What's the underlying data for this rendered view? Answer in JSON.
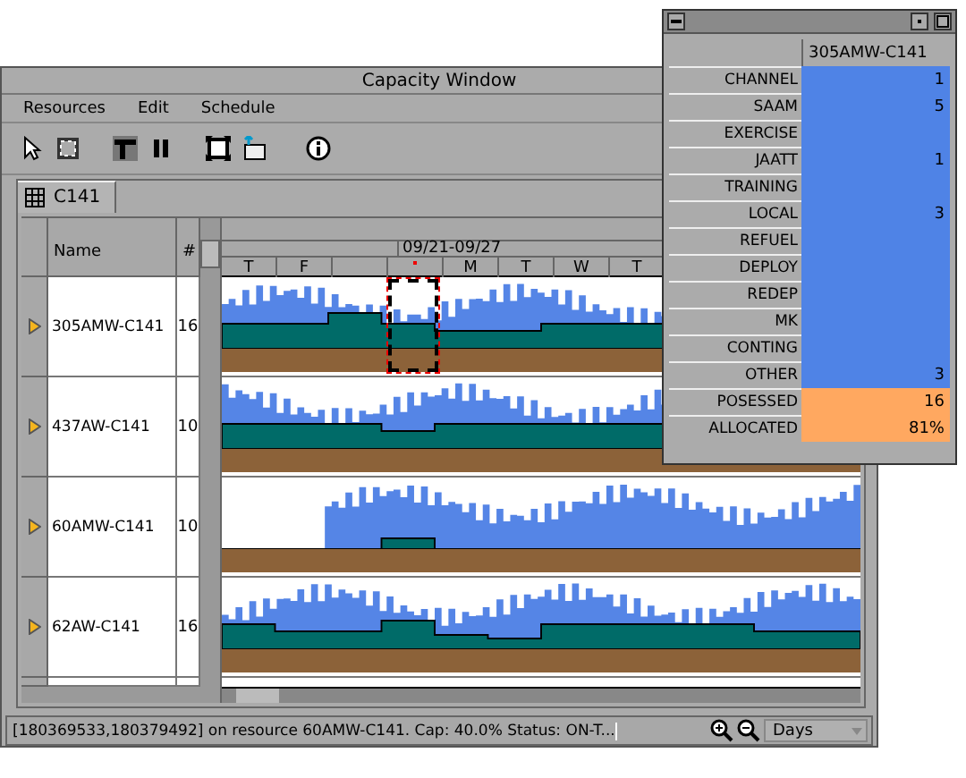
{
  "main_window": {
    "title": "Capacity Window",
    "menu": [
      "Resources",
      "Edit",
      "Schedule"
    ],
    "tab": {
      "label": "C141",
      "selected": true
    },
    "columns": [
      "Name",
      "#"
    ],
    "date_range": "09/21-09/27",
    "days": [
      {
        "kind": "day",
        "label": "T"
      },
      {
        "kind": "day",
        "label": "F"
      },
      {
        "kind": "blank"
      },
      {
        "kind": "marker"
      },
      {
        "kind": "day",
        "label": "M"
      },
      {
        "kind": "day",
        "label": "T"
      },
      {
        "kind": "day",
        "label": "W"
      },
      {
        "kind": "day",
        "label": "T"
      }
    ],
    "rows": [
      {
        "name": "305AMW-C141",
        "count": "16",
        "selected": true
      },
      {
        "name": "437AW-C141",
        "count": "10",
        "selected": false
      },
      {
        "name": "60AMW-C141",
        "count": "10",
        "selected": false
      },
      {
        "name": "62AW-C141",
        "count": "16",
        "selected": false
      }
    ],
    "status": "[180369533,180379492] on resource 60AMW-C141. Cap: 40.0% Status: ON-T...",
    "scale": "Days"
  },
  "detail_window": {
    "resource": "305AMW-C141",
    "rows": [
      {
        "label": "CHANNEL",
        "value": "1",
        "kind": "activity"
      },
      {
        "label": "SAAM",
        "value": "5",
        "kind": "activity"
      },
      {
        "label": "EXERCISE",
        "kind": "activity"
      },
      {
        "label": "JAATT",
        "value": "1",
        "kind": "activity"
      },
      {
        "label": "TRAINING",
        "kind": "activity"
      },
      {
        "label": "LOCAL",
        "value": "3",
        "kind": "activity"
      },
      {
        "label": "REFUEL",
        "kind": "activity"
      },
      {
        "label": "DEPLOY",
        "kind": "activity"
      },
      {
        "label": "REDEP",
        "kind": "activity"
      },
      {
        "label": "MK",
        "kind": "activity"
      },
      {
        "label": "CONTING",
        "kind": "activity"
      },
      {
        "label": "OTHER",
        "value": "3",
        "kind": "activity"
      },
      {
        "label": "POSESSED",
        "value": "16",
        "kind": "total"
      },
      {
        "label": "ALLOCATED",
        "value": "81%",
        "kind": "total"
      }
    ]
  }
}
